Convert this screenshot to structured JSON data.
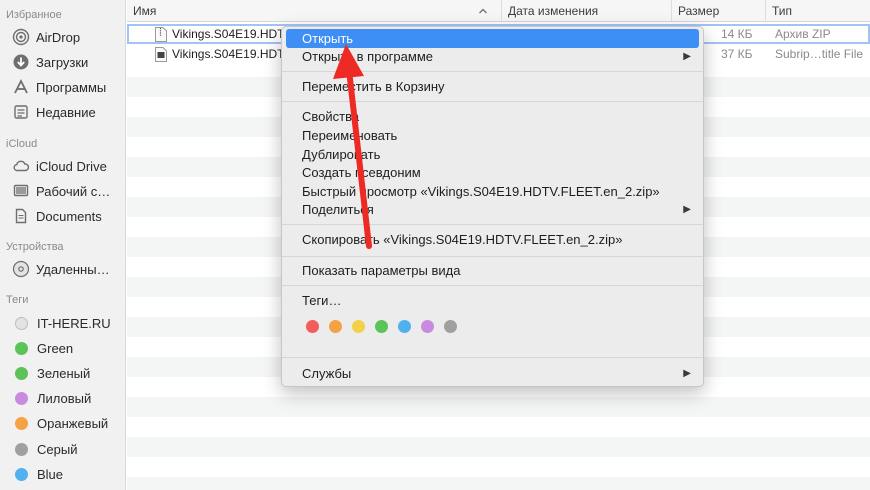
{
  "sidebar": {
    "favorites_title": "Избранное",
    "favorites": [
      {
        "label": "AirDrop",
        "icon": "airdrop-icon"
      },
      {
        "label": "Загрузки",
        "icon": "downloads-icon"
      },
      {
        "label": "Программы",
        "icon": "applications-icon"
      },
      {
        "label": "Недавние",
        "icon": "recents-icon"
      }
    ],
    "icloud_title": "iCloud",
    "icloud": [
      {
        "label": "iCloud Drive",
        "icon": "cloud-icon"
      },
      {
        "label": "Рабочий с…",
        "icon": "desktop-icon"
      },
      {
        "label": "Documents",
        "icon": "document-icon"
      }
    ],
    "devices_title": "Устройства",
    "devices": [
      {
        "label": "Удаленны…",
        "icon": "disc-icon"
      }
    ],
    "tags_title": "Теги",
    "tags": [
      {
        "label": "IT-HERE.RU",
        "color": "#e0e0e0"
      },
      {
        "label": "Green",
        "color": "#5cc25a"
      },
      {
        "label": "Зеленый",
        "color": "#5cc25a"
      },
      {
        "label": "Лиловый",
        "color": "#c98be0"
      },
      {
        "label": "Оранжевый",
        "color": "#f4a244"
      },
      {
        "label": "Серый",
        "color": "#a0a0a0"
      },
      {
        "label": "Blue",
        "color": "#4fb2ef"
      }
    ]
  },
  "columns": {
    "name": "Имя",
    "date": "Дата изменения",
    "size": "Размер",
    "kind": "Тип"
  },
  "files": [
    {
      "name": "Vikings.S04E19.HDT",
      "size": "14 КБ",
      "kind": "Архив ZIP",
      "icon": "zip-file-icon"
    },
    {
      "name": "Vikings.S04E19.HDT",
      "size": "37 КБ",
      "kind": "Subrip…title File",
      "icon": "subtitle-file-icon"
    }
  ],
  "context_menu": {
    "open": "Открыть",
    "open_with": "Открыть в программе",
    "move_to_trash": "Переместить в Корзину",
    "get_info": "Свойства",
    "rename": "Переименовать",
    "duplicate": "Дублировать",
    "make_alias": "Создать псевдоним",
    "quick_look": "Быстрый просмотр «Vikings.S04E19.HDTV.FLEET.en_2.zip»",
    "share": "Поделиться",
    "copy": "Скопировать «Vikings.S04E19.HDTV.FLEET.en_2.zip»",
    "show_view_options": "Показать параметры вида",
    "tags": "Теги…",
    "tag_colors": [
      "#f25d5b",
      "#f4a244",
      "#f4cf4a",
      "#5cc25a",
      "#4fb2ef",
      "#c98be0",
      "#a0a0a0"
    ],
    "services": "Службы"
  },
  "colors": {
    "highlight": "#3d8ef5",
    "annotation_arrow": "#ee2a24"
  }
}
